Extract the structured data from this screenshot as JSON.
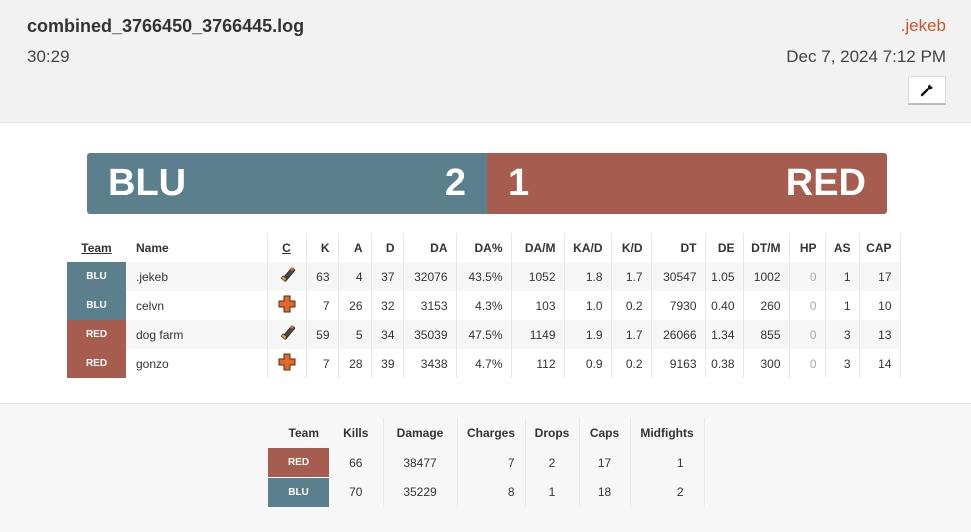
{
  "header": {
    "log_name": "combined_3766450_3766445.log",
    "duration": "30:29",
    "uploader": ".jekeb",
    "date": "Dec 7, 2024 7:12 PM",
    "tools_icon": "wrench-icon"
  },
  "score": {
    "blu_label": "BLU",
    "blu_score": "2",
    "red_label": "RED",
    "red_score": "1",
    "blu_color": "#5b7f8d",
    "red_color": "#a65c4e"
  },
  "players_table": {
    "headers": [
      "Team",
      "Name",
      "C",
      "K",
      "A",
      "D",
      "DA",
      "DA%",
      "DA/M",
      "KA/D",
      "K/D",
      "DT",
      "DE",
      "DT/M",
      "HP",
      "AS",
      "CAP"
    ],
    "rows": [
      {
        "team": "BLU",
        "name": ".jekeb",
        "class_icon": "pyro-icon",
        "k": "63",
        "a": "4",
        "d": "37",
        "da": "32076",
        "da_pct": "43.5%",
        "dapm": "1052",
        "kad": "1.8",
        "kd": "1.7",
        "dt": "30547",
        "de": "1.05",
        "dtm": "1002",
        "hp": "0",
        "as": "1",
        "cap": "17"
      },
      {
        "team": "BLU",
        "name": "celvn",
        "class_icon": "medic-icon",
        "k": "7",
        "a": "26",
        "d": "32",
        "da": "3153",
        "da_pct": "4.3%",
        "dapm": "103",
        "kad": "1.0",
        "kd": "0.2",
        "dt": "7930",
        "de": "0.40",
        "dtm": "260",
        "hp": "0",
        "as": "1",
        "cap": "10"
      },
      {
        "team": "RED",
        "name": "dog farm",
        "class_icon": "pyro-icon",
        "k": "59",
        "a": "5",
        "d": "34",
        "da": "35039",
        "da_pct": "47.5%",
        "dapm": "1149",
        "kad": "1.9",
        "kd": "1.7",
        "dt": "26066",
        "de": "1.34",
        "dtm": "855",
        "hp": "0",
        "as": "3",
        "cap": "13"
      },
      {
        "team": "RED",
        "name": "gonzo",
        "class_icon": "medic-icon",
        "k": "7",
        "a": "28",
        "d": "39",
        "da": "3438",
        "da_pct": "4.7%",
        "dapm": "112",
        "kad": "0.9",
        "kd": "0.2",
        "dt": "9163",
        "de": "0.38",
        "dtm": "300",
        "hp": "0",
        "as": "3",
        "cap": "14"
      }
    ]
  },
  "team_table": {
    "headers": [
      "Team",
      "Kills",
      "Damage",
      "Charges",
      "Drops",
      "Caps",
      "Midfights"
    ],
    "rows": [
      {
        "team": "RED",
        "kills": "66",
        "damage": "38477",
        "charges": "7",
        "drops": "2",
        "caps": "17",
        "midfights": "1"
      },
      {
        "team": "BLU",
        "kills": "70",
        "damage": "35229",
        "charges": "8",
        "drops": "1",
        "caps": "18",
        "midfights": "2"
      }
    ]
  }
}
